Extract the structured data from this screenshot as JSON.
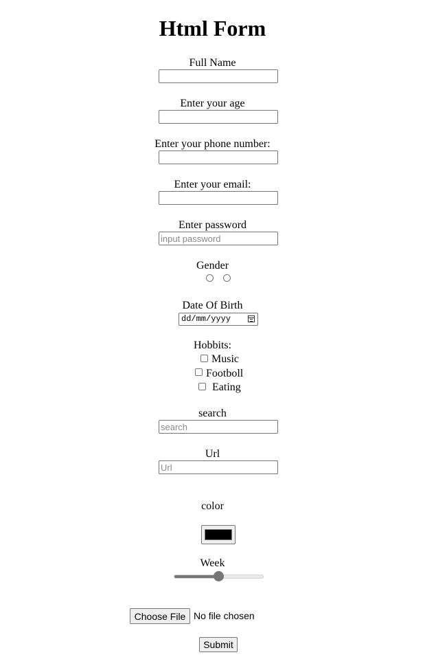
{
  "form": {
    "title": "Html Form",
    "full_name": {
      "label": "Full Name",
      "value": ""
    },
    "age": {
      "label": "Enter your age",
      "value": ""
    },
    "phone": {
      "label": "Enter your phone number:",
      "value": ""
    },
    "email": {
      "label": "Enter your email:",
      "value": ""
    },
    "password": {
      "label": "Enter password",
      "placeholder": "input password"
    },
    "gender": {
      "label": "Gender",
      "options_selected": [
        false,
        false
      ]
    },
    "dob": {
      "label": "Date Of Birth",
      "placeholder": "dd/mm/yyyy"
    },
    "hobbies": {
      "label": "Hobbits:",
      "items": [
        {
          "label": "Music",
          "checked": false
        },
        {
          "label": "Footboll",
          "checked": false
        },
        {
          "label": "Eating",
          "checked": false
        }
      ]
    },
    "search": {
      "label": "search",
      "placeholder": "search"
    },
    "url": {
      "label": "Url",
      "placeholder": "Url"
    },
    "color": {
      "label": "color",
      "value": "#000000"
    },
    "week": {
      "label": "Week",
      "slider_fraction": 0.5
    },
    "file": {
      "button_label": "Choose File",
      "status": "No file chosen"
    },
    "submit_label": "Submit"
  },
  "colors": {
    "border": "#767676",
    "placeholder": "#8a8a8a",
    "button_bg": "#efefef",
    "swatch": "#000000"
  },
  "icons": [
    "calendar-icon"
  ]
}
